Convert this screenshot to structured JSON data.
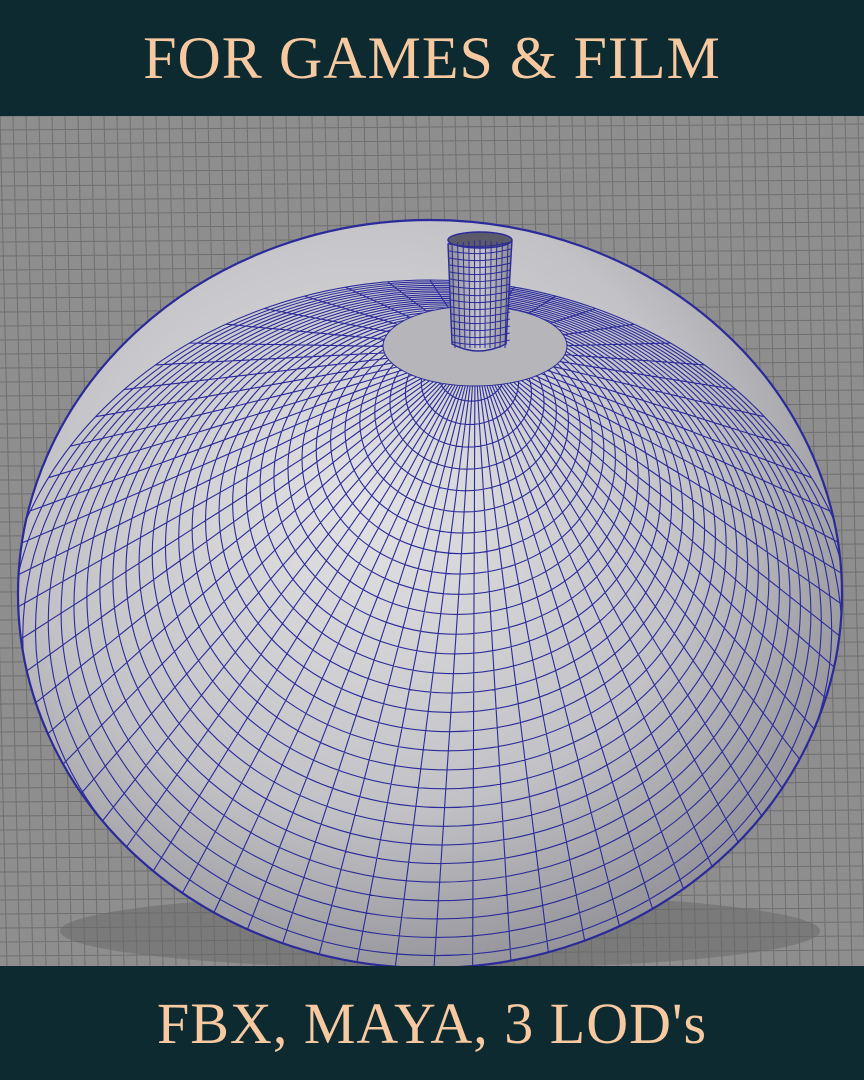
{
  "banner_top": {
    "text": "FOR GAMES & FILM"
  },
  "banner_bottom": {
    "text": "FBX, MAYA, 3 LOD's"
  },
  "colors": {
    "banner_bg": "#0d2a30",
    "banner_text": "#f7c9a1",
    "grid_bg": "#8e8e8e",
    "grid_line": "#6f6f6f",
    "mesh_surface": "#c4c4c7",
    "wireframe": "#2a2a9a"
  },
  "render": {
    "subject": "wireframe-mesh",
    "style": "quad-wireframe-on-shaded-surface"
  }
}
